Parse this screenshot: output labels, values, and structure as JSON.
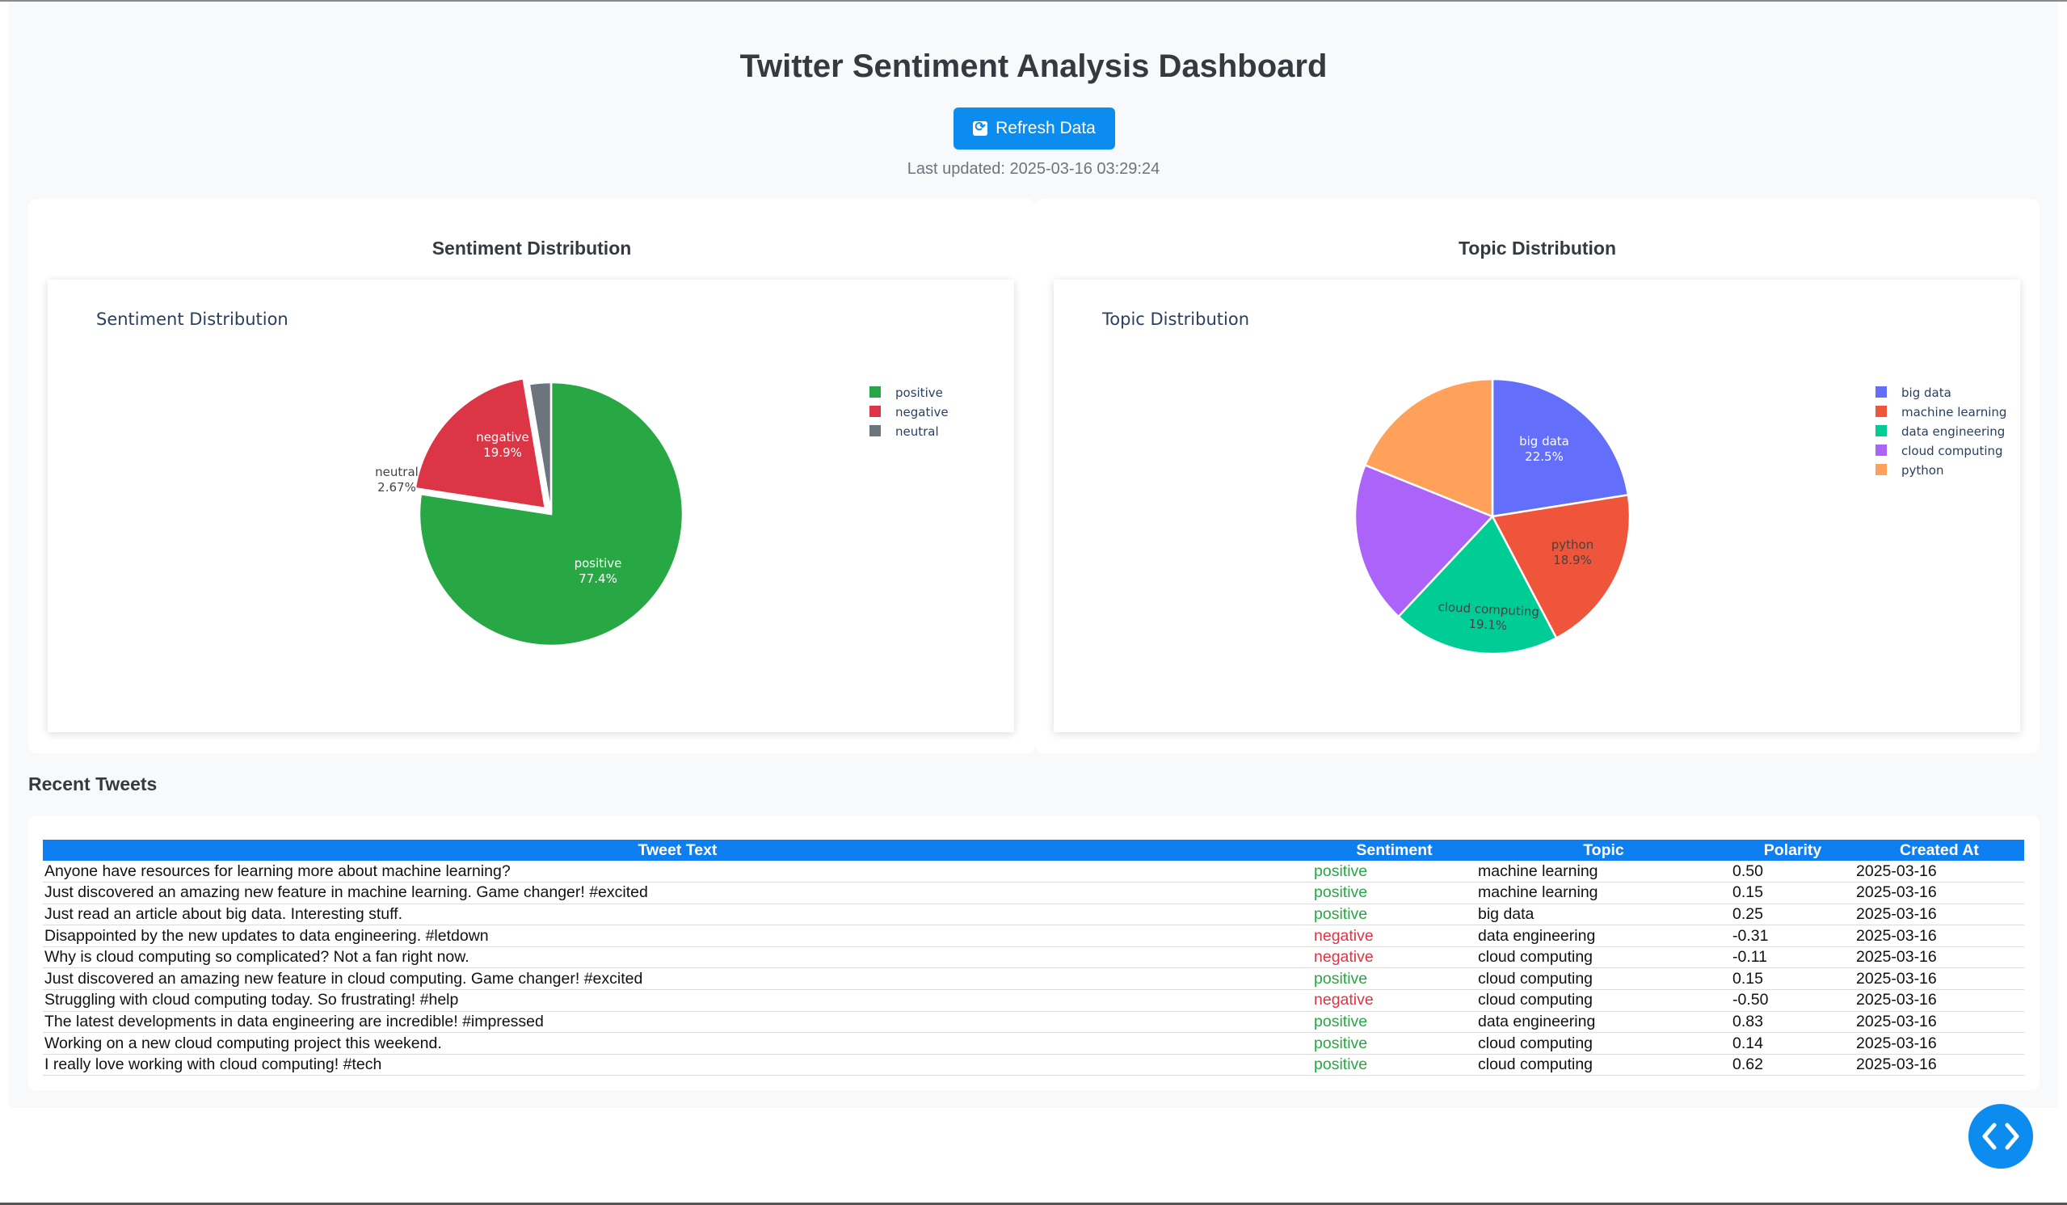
{
  "header": {
    "title": "Twitter Sentiment Analysis Dashboard",
    "refresh_label": "Refresh Data",
    "last_updated": "Last updated: 2025-03-16 03:29:24"
  },
  "sentiment_card": {
    "title": "Sentiment Distribution",
    "chart_title": "Sentiment Distribution"
  },
  "topic_card": {
    "title": "Topic Distribution",
    "chart_title": "Topic Distribution"
  },
  "recent_tweets": {
    "title": "Recent Tweets",
    "columns": [
      "Tweet Text",
      "Sentiment",
      "Topic",
      "Polarity",
      "Created At"
    ],
    "rows": [
      {
        "text": "Anyone have resources for learning more about machine learning?",
        "sentiment": "positive",
        "topic": "machine learning",
        "polarity": "0.50",
        "created": "2025-03-16"
      },
      {
        "text": "Just discovered an amazing new feature in machine learning. Game changer! #excited",
        "sentiment": "positive",
        "topic": "machine learning",
        "polarity": "0.15",
        "created": "2025-03-16"
      },
      {
        "text": "Just read an article about big data. Interesting stuff.",
        "sentiment": "positive",
        "topic": "big data",
        "polarity": "0.25",
        "created": "2025-03-16"
      },
      {
        "text": "Disappointed by the new updates to data engineering. #letdown",
        "sentiment": "negative",
        "topic": "data engineering",
        "polarity": "-0.31",
        "created": "2025-03-16"
      },
      {
        "text": "Why is cloud computing so complicated? Not a fan right now.",
        "sentiment": "negative",
        "topic": "cloud computing",
        "polarity": "-0.11",
        "created": "2025-03-16"
      },
      {
        "text": "Just discovered an amazing new feature in cloud computing. Game changer! #excited",
        "sentiment": "positive",
        "topic": "cloud computing",
        "polarity": "0.15",
        "created": "2025-03-16"
      },
      {
        "text": "Struggling with cloud computing today. So frustrating! #help",
        "sentiment": "negative",
        "topic": "cloud computing",
        "polarity": "-0.50",
        "created": "2025-03-16"
      },
      {
        "text": "The latest developments in data engineering are incredible! #impressed",
        "sentiment": "positive",
        "topic": "data engineering",
        "polarity": "0.83",
        "created": "2025-03-16"
      },
      {
        "text": "Working on a new cloud computing project this weekend.",
        "sentiment": "positive",
        "topic": "cloud computing",
        "polarity": "0.14",
        "created": "2025-03-16"
      },
      {
        "text": "I really love working with cloud computing! #tech",
        "sentiment": "positive",
        "topic": "cloud computing",
        "polarity": "0.62",
        "created": "2025-03-16"
      }
    ]
  },
  "colors": {
    "accent": "#0d8cf0",
    "positive": "#28a745",
    "negative": "#dc3545"
  },
  "icons": {
    "refresh": "refresh-icon",
    "fab": "code-brackets-icon"
  },
  "chart_data": [
    {
      "type": "pie",
      "title": "Sentiment Distribution",
      "labels": [
        "positive",
        "negative",
        "neutral"
      ],
      "values": [
        77.4,
        19.9,
        2.67
      ],
      "value_labels": [
        "77.4%",
        "19.9%",
        "2.67%"
      ],
      "colors": [
        "#28a745",
        "#dc3545",
        "#6c757d"
      ],
      "pulled": "negative",
      "legend": "top-right"
    },
    {
      "type": "pie",
      "title": "Topic Distribution",
      "labels": [
        "big data",
        "machine learning",
        "data engineering",
        "cloud computing",
        "python"
      ],
      "values": [
        22.5,
        19.8,
        19.7,
        19.1,
        18.9
      ],
      "value_labels": [
        "22.5%",
        "19.8%",
        "19.7%",
        "19.1%",
        "18.9%"
      ],
      "colors": [
        "#636efa",
        "#ef553b",
        "#00cc96",
        "#ab63fa",
        "#ffa15a"
      ],
      "legend": "top-right"
    }
  ]
}
